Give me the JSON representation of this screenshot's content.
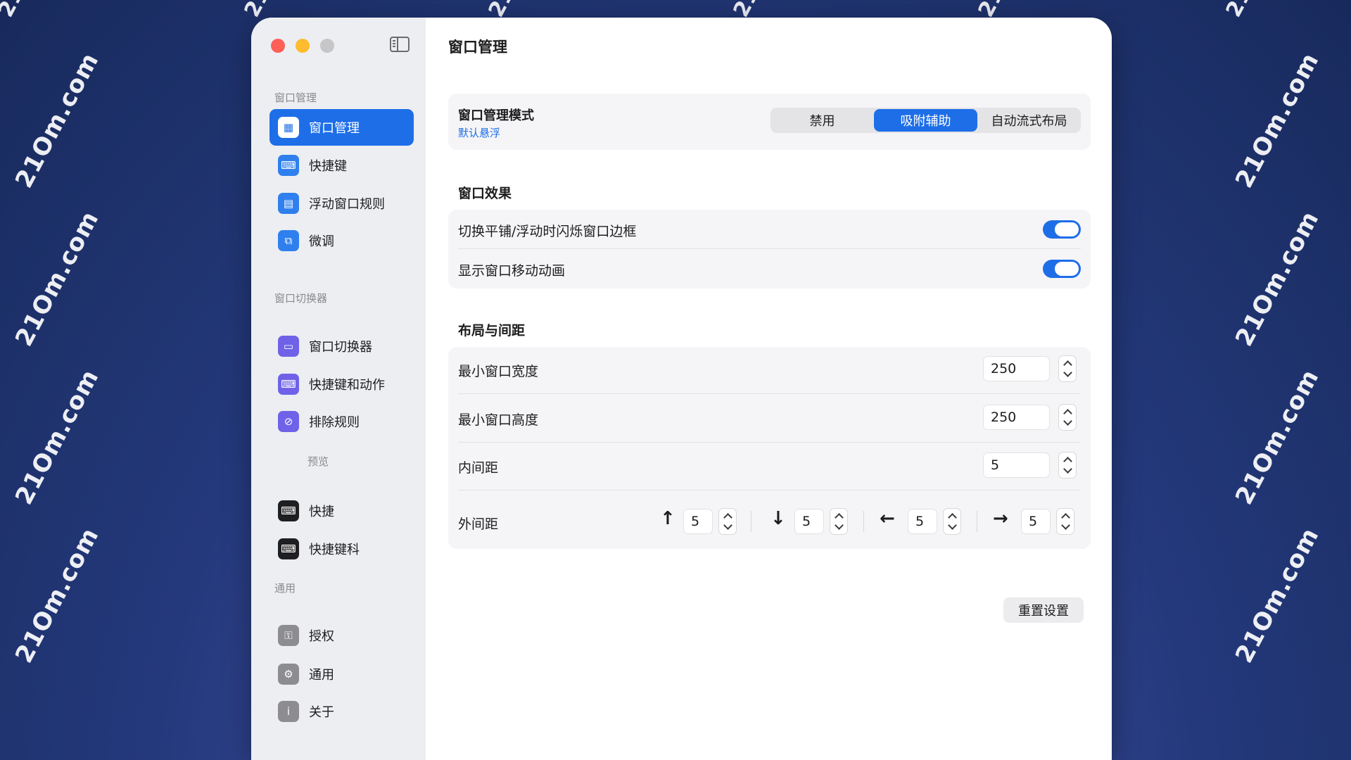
{
  "watermark": "21Om.com",
  "window": {
    "title": "窗口管理",
    "sidebar": {
      "sections": [
        {
          "header": "窗口管理",
          "items": [
            {
              "label": "窗口管理",
              "icon": "window-grid-icon",
              "active": true
            },
            {
              "label": "快捷键",
              "icon": "keyboard-icon"
            },
            {
              "label": "浮动窗口规则",
              "icon": "document-icon"
            },
            {
              "label": "微调",
              "icon": "window-adjust-icon"
            }
          ]
        },
        {
          "header": "窗口切换器",
          "items": [
            {
              "label": "窗口切换器",
              "icon": "window-switcher-icon"
            },
            {
              "label": "快捷键和动作",
              "icon": "keyboard-icon"
            },
            {
              "label": "排除规则",
              "icon": "exclude-icon"
            }
          ]
        },
        {
          "header": "预览",
          "items": [
            {
              "label": "快捷",
              "icon": "keyboard-icon"
            },
            {
              "label": "快捷键科",
              "icon": "keyboard-icon"
            }
          ]
        },
        {
          "header": "通用",
          "items": [
            {
              "label": "授权",
              "icon": "key-icon"
            },
            {
              "label": "通用",
              "icon": "gear-icon"
            },
            {
              "label": "关于",
              "icon": "info-icon"
            }
          ]
        }
      ]
    },
    "mode": {
      "label": "窗口管理模式",
      "sublabel": "默认悬浮",
      "options": [
        "禁用",
        "吸附辅助",
        "自动流式布局"
      ],
      "selected": "吸附辅助"
    },
    "effects": {
      "title": "窗口效果",
      "rows": [
        {
          "label": "切换平铺/浮动时闪烁窗口边框",
          "on": true
        },
        {
          "label": "显示窗口移动动画",
          "on": true
        }
      ]
    },
    "layout": {
      "title": "布局与间距",
      "min_width_label": "最小窗口宽度",
      "min_width": "250",
      "min_height_label": "最小窗口高度",
      "min_height": "250",
      "inner_gap_label": "内间距",
      "inner_gap": "5",
      "outer_gap_label": "外间距",
      "outer": {
        "up": "5",
        "down": "5",
        "left": "5",
        "right": "5"
      }
    },
    "reset_label": "重置设置"
  },
  "colors": {
    "accent": "#1e6ee8"
  }
}
